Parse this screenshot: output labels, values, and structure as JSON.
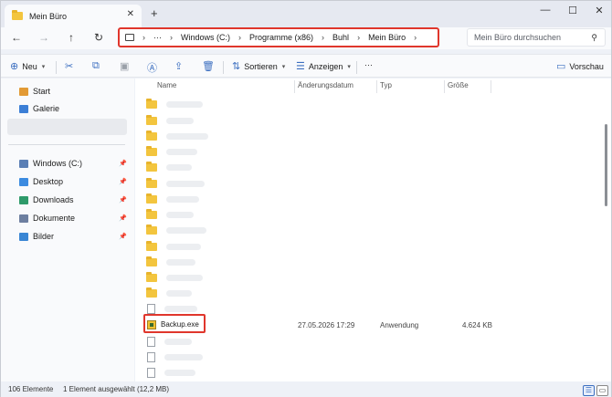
{
  "window": {
    "tab_title": "Mein Büro",
    "tab_close": "✕",
    "new_tab": "+",
    "minimize": "—",
    "maximize": "☐",
    "close": "✕"
  },
  "nav": {
    "back": "←",
    "forward": "→",
    "up": "↑",
    "refresh": "↻"
  },
  "address": {
    "more": "···",
    "separator": "›",
    "crumbs": [
      "Windows (C:)",
      "Programme (x86)",
      "Buhl",
      "Mein Büro"
    ]
  },
  "search": {
    "placeholder": "Mein Büro durchsuchen",
    "icon": "search-icon"
  },
  "toolbar": {
    "new_label": "Neu",
    "sort_label": "Sortieren",
    "view_label": "Anzeigen",
    "more": "···",
    "preview_label": "Vorschau"
  },
  "sidebar": {
    "quick": [
      {
        "label": "Start",
        "icon": "home-icon",
        "color": "#e29a35"
      },
      {
        "label": "Galerie",
        "icon": "gallery-icon",
        "color": "#3c7fd6"
      }
    ],
    "pinned": [
      {
        "label": "Windows (C:)",
        "icon": "drive-icon",
        "color": "#5b7fb5"
      },
      {
        "label": "Desktop",
        "icon": "desktop-icon",
        "color": "#3c8be0"
      },
      {
        "label": "Downloads",
        "icon": "download-icon",
        "color": "#2e9a6a"
      },
      {
        "label": "Dokumente",
        "icon": "documents-icon",
        "color": "#6d7fa0"
      },
      {
        "label": "Bilder",
        "icon": "pictures-icon",
        "color": "#3a86d4"
      }
    ]
  },
  "columns": {
    "name": "Name",
    "date": "Änderungsdatum",
    "type": "Typ",
    "size": "Größe"
  },
  "selected_file": {
    "name": "Backup.exe",
    "date": "27.05.2026 17:29",
    "type": "Anwendung",
    "size": "4.624 KB"
  },
  "status": {
    "count": "106 Elemente",
    "selection": "1 Element ausgewählt (12,2 MB)"
  }
}
